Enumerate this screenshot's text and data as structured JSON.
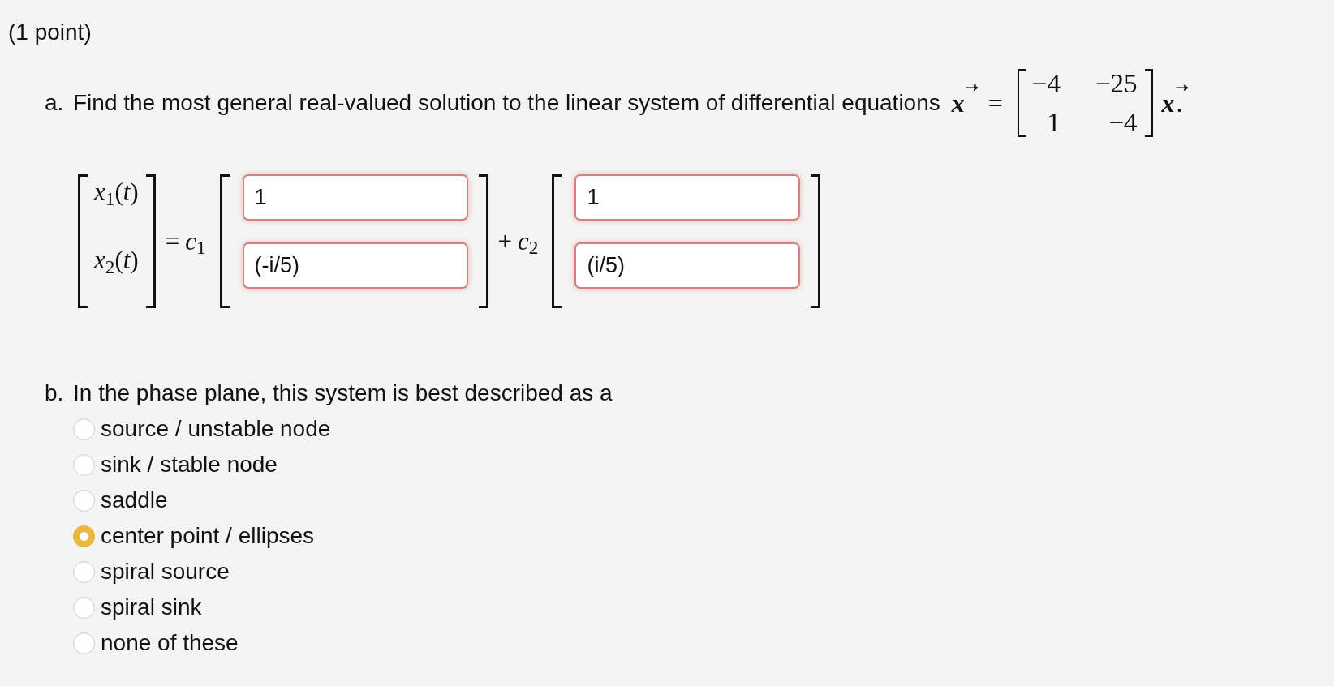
{
  "points": "(1 point)",
  "part_a": {
    "marker": "a.",
    "prompt": "Find the most general real-valued solution to the linear system of differential equations",
    "equation": {
      "lhs": {
        "symbol": "x",
        "prime": true
      },
      "equals": "=",
      "matrix": [
        [
          "−4",
          "−25"
        ],
        [
          "1",
          "−4"
        ]
      ],
      "rhs": {
        "symbol": "x"
      },
      "end": "."
    },
    "solution": {
      "lhs": [
        "*x*$_{1}$(*t*)",
        "*x*$_{2}$(*t*)"
      ],
      "terms": [
        {
          "operator": "=",
          "coefficient": "*c*$_{1}$",
          "entries": [
            {
              "value": "1",
              "correct": false
            },
            {
              "value": "(-i/5)",
              "correct": false
            }
          ]
        },
        {
          "operator": "+",
          "coefficient": "*c*$_{2}$",
          "entries": [
            {
              "value": "1",
              "correct": false
            },
            {
              "value": "(i/5)",
              "correct": false
            }
          ]
        }
      ]
    }
  },
  "part_b": {
    "marker": "b.",
    "prompt": "In the phase plane, this system is best described as a",
    "options": [
      {
        "label": "source / unstable node",
        "selected": false
      },
      {
        "label": "sink / stable node",
        "selected": false
      },
      {
        "label": "saddle",
        "selected": false
      },
      {
        "label": "center point / ellipses",
        "selected": true
      },
      {
        "label": "spiral source",
        "selected": false
      },
      {
        "label": "spiral sink",
        "selected": false
      },
      {
        "label": "none of these",
        "selected": false
      }
    ]
  }
}
